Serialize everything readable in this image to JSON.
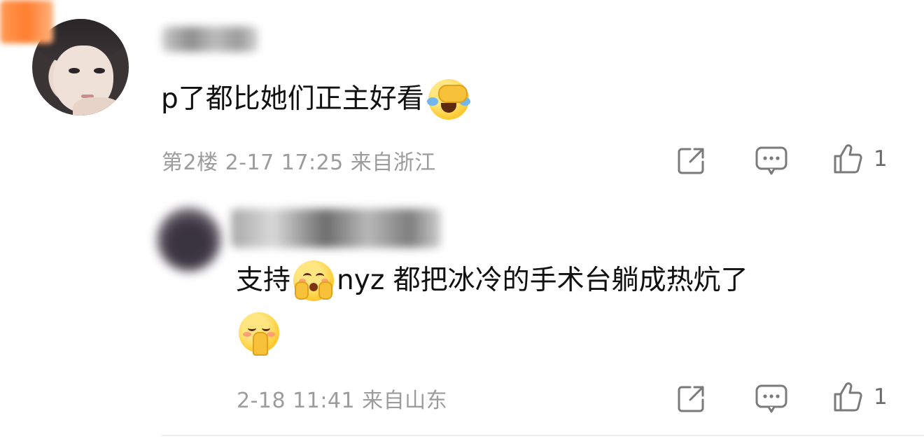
{
  "comment": {
    "text": "p了都比她们正主好看",
    "emoji": "face-with-tears-of-joy-icon",
    "meta": {
      "floor": "第2楼",
      "date": "2-17",
      "time": "17:25",
      "location": "来自浙江"
    },
    "actions": {
      "share_icon": "share-icon",
      "comment_icon": "comment-icon",
      "like_icon": "thumbs-up-icon",
      "like_count": "1"
    }
  },
  "reply": {
    "text_before_emoji": "支持",
    "text_after_emoji": "nyz 都把冰冷的手术台躺成热炕了",
    "emoji_1": "hugging-face-icon",
    "emoji_2": "praying-blush-face-icon",
    "meta": {
      "date": "2-18",
      "time": "11:41",
      "location": "来自山东"
    },
    "actions": {
      "share_icon": "share-icon",
      "comment_icon": "comment-icon",
      "like_icon": "thumbs-up-icon",
      "like_count": "1"
    }
  },
  "colors": {
    "text": "#111111",
    "meta_text": "#9c9c9c",
    "icon": "#7a7a7a",
    "badge": "#ff7e2e"
  }
}
